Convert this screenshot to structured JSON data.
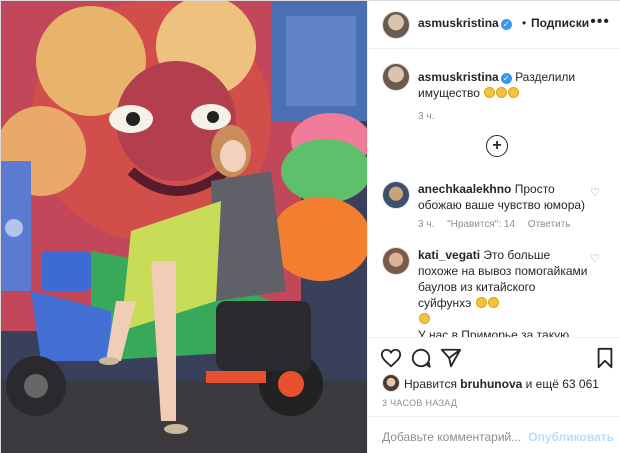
{
  "post": {
    "author": "asmuskristina",
    "follow_dot": "•",
    "follow_label": "Подписки",
    "more_glyph": "•••",
    "caption": "Разделили имущество",
    "caption_time": "3 ч."
  },
  "load_more_glyph": "+",
  "comments": [
    {
      "user": "anechkaalekhno",
      "text": "Просто обожаю ваше чувство юмора)",
      "time": "3 ч.",
      "likes": "\"Нравится\": 14",
      "reply": "Ответить"
    },
    {
      "user": "kati_vegati",
      "text_1": "Это больше похоже на вывоз помогайками баулов из китайского суйфунхэ",
      "text_2": "У нас в Приморье за такую услугу раньше бесплатно к"
    }
  ],
  "likes": {
    "prefix": "Нравится",
    "user": "bruhunova",
    "suffix": "и ещё 63 061"
  },
  "timestamp": "3 ЧАСОВ НАЗАД",
  "add_comment": {
    "placeholder": "Добавьте комментарий...",
    "post_label": "Опубликовать"
  },
  "icons": [
    "verified-icon",
    "more-icon",
    "heart-icon",
    "comment-icon",
    "share-icon",
    "bookmark-icon",
    "load-more-icon"
  ],
  "colors": {
    "link_blue": "#3897f0",
    "post_disabled": "#b2dffc",
    "meta_gray": "#8e8e8e"
  }
}
